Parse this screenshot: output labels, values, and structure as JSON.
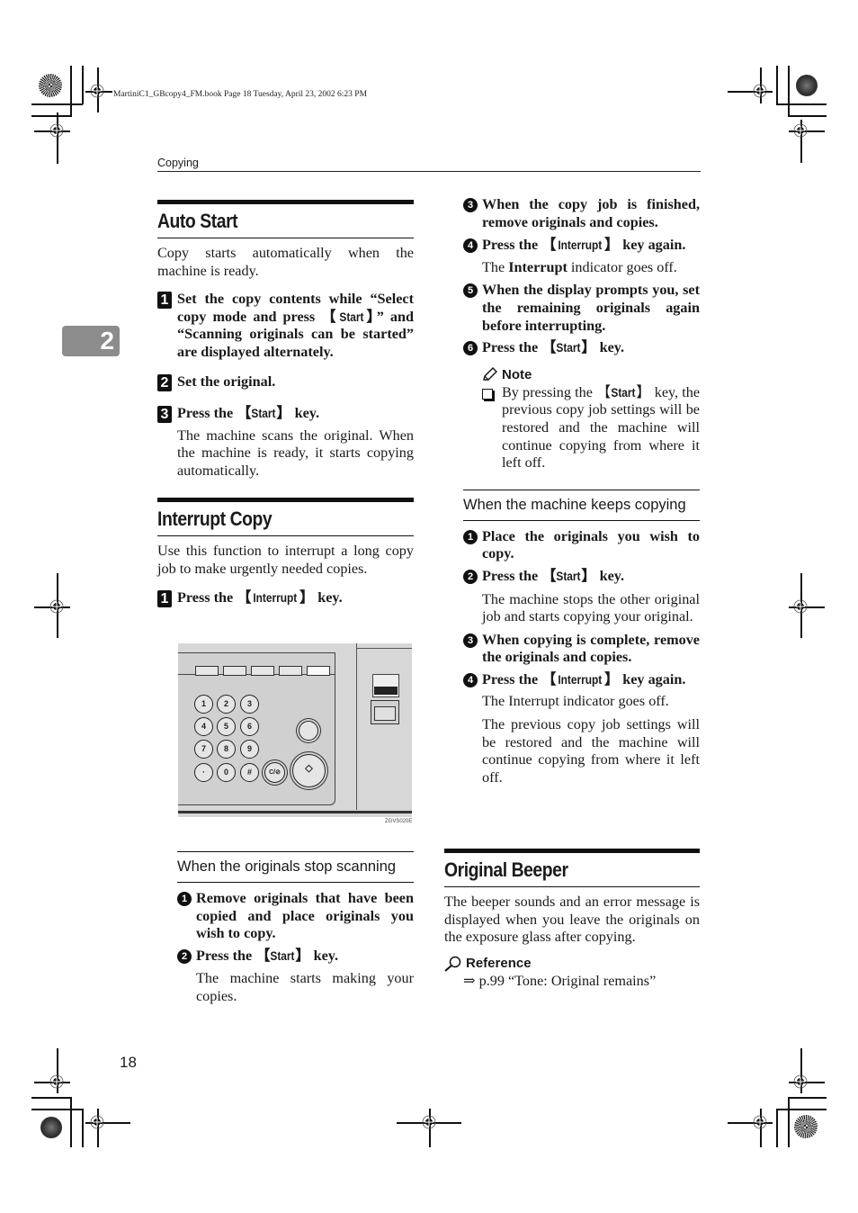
{
  "print_meta": "MartiniC1_GBcopy4_FM.book  Page 18  Tuesday, April 23, 2002  6:23 PM",
  "running_head": "Copying",
  "chapter_tab": "2",
  "page_number": "18",
  "auto_start": {
    "title": "Auto Start",
    "intro": "Copy starts automatically when the machine is ready.",
    "steps": [
      {
        "num": "1",
        "pre": "Set the copy contents while “Select copy mode and press ",
        "key": "Start",
        "post": "” and “Scanning originals can be started” are displayed alternately."
      },
      {
        "num": "2",
        "pre": "Set the original.",
        "key": "",
        "post": ""
      },
      {
        "num": "3",
        "pre": "Press the ",
        "key": "Start",
        "post": " key."
      }
    ],
    "step3_desc": "The machine scans the original. When the machine is ready, it starts copying automatically."
  },
  "interrupt_copy": {
    "title": "Interrupt Copy",
    "intro": "Use this function to interrupt a long copy job to make urgently needed copies.",
    "step1": {
      "num": "1",
      "pre": "Press the ",
      "key": "Interrupt",
      "post": " key."
    },
    "figure_code": "ZGVS020E",
    "keypad": [
      "1",
      "2",
      "3",
      "4",
      "5",
      "6",
      "7",
      "8",
      "9",
      "·",
      "0",
      "#"
    ],
    "clear_key": "C/⊘",
    "stop_scanning": {
      "heading": "When the originals stop scanning",
      "steps": [
        {
          "num": "1",
          "pre": "Remove originals that have been copied and place originals you wish to copy.",
          "key": "",
          "post": ""
        },
        {
          "num": "2",
          "pre": "Press the ",
          "key": "Start",
          "post": " key."
        }
      ],
      "step2_desc": "The machine starts making your copies."
    },
    "continued_steps": [
      {
        "num": "3",
        "pre": "When the copy job is finished, remove originals and copies.",
        "key": "",
        "post": ""
      },
      {
        "num": "4",
        "pre": "Press the ",
        "key": "Interrupt",
        "post": " key again."
      },
      {
        "num": "5",
        "pre": "When the display prompts you, set the remaining originals again before interrupting.",
        "key": "",
        "post": ""
      },
      {
        "num": "6",
        "pre": "Press the ",
        "key": "Start",
        "post": " key."
      }
    ],
    "step4_desc_pre": "The ",
    "step4_desc_bold": "Interrupt",
    "step4_desc_post": " indicator goes off.",
    "note": {
      "label": "Note",
      "pre": "By pressing the ",
      "key": "Start",
      "post": " key, the previous copy job settings will be restored and the machine will continue copying from where it left off."
    },
    "keeps_copying": {
      "heading": "When the machine keeps copying",
      "steps": [
        {
          "num": "1",
          "pre": "Place the originals you wish to copy.",
          "key": "",
          "post": ""
        },
        {
          "num": "2",
          "pre": "Press the ",
          "key": "Start",
          "post": " key."
        },
        {
          "num": "3",
          "pre": "When copying is complete, remove the originals and copies.",
          "key": "",
          "post": ""
        },
        {
          "num": "4",
          "pre": "Press the ",
          "key": "Interrupt",
          "post": " key again."
        }
      ],
      "step2_desc": "The machine stops the other original job and starts copying your original.",
      "step4_desc1": "The Interrupt indicator goes off.",
      "step4_desc2": "The previous copy job settings will be restored and the machine will continue copying from where it left off."
    }
  },
  "original_beeper": {
    "title": "Original Beeper",
    "intro": "The beeper sounds and an error message is displayed when you leave the originals on the exposure glass after copying.",
    "reference_label": "Reference",
    "reference_text": "⇒ p.99 “Tone: Original remains”"
  }
}
